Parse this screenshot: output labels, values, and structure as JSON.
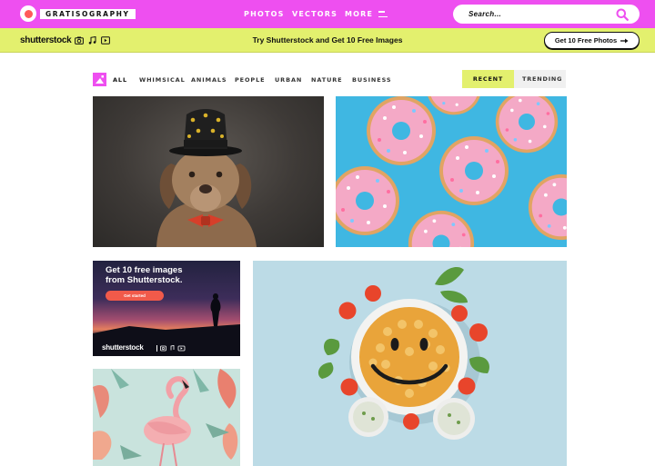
{
  "header": {
    "logo_text": "GRATISOGRAPHY",
    "nav": [
      "PHOTOS",
      "VECTORS",
      "MORE"
    ],
    "search_placeholder": "Search..."
  },
  "promo": {
    "brand": "shutterstock",
    "text": "Try Shutterstock and Get 10 Free Images",
    "button_label": "Get 10 Free Photos"
  },
  "filters": {
    "categories": [
      "ALL",
      "WHIMSICAL",
      "ANIMALS",
      "PEOPLE",
      "URBAN",
      "NATURE",
      "BUSINESS"
    ],
    "active_category": "ALL",
    "sort": [
      "RECENT",
      "TRENDING"
    ],
    "active_sort": "RECENT"
  },
  "ad": {
    "headline_line1": "Get 10 free images",
    "headline_line2": "from Shutterstock.",
    "button_label": "Get started",
    "brand": "shutterstock"
  },
  "colors": {
    "brand_pink": "#ee4ff0",
    "promo_yellow": "#e3f06e",
    "ad_button": "#f15a4a"
  },
  "icons": [
    "search-icon",
    "camera-icon",
    "music-note-icon",
    "video-icon",
    "arrow-right-icon",
    "hamburger-icon"
  ]
}
